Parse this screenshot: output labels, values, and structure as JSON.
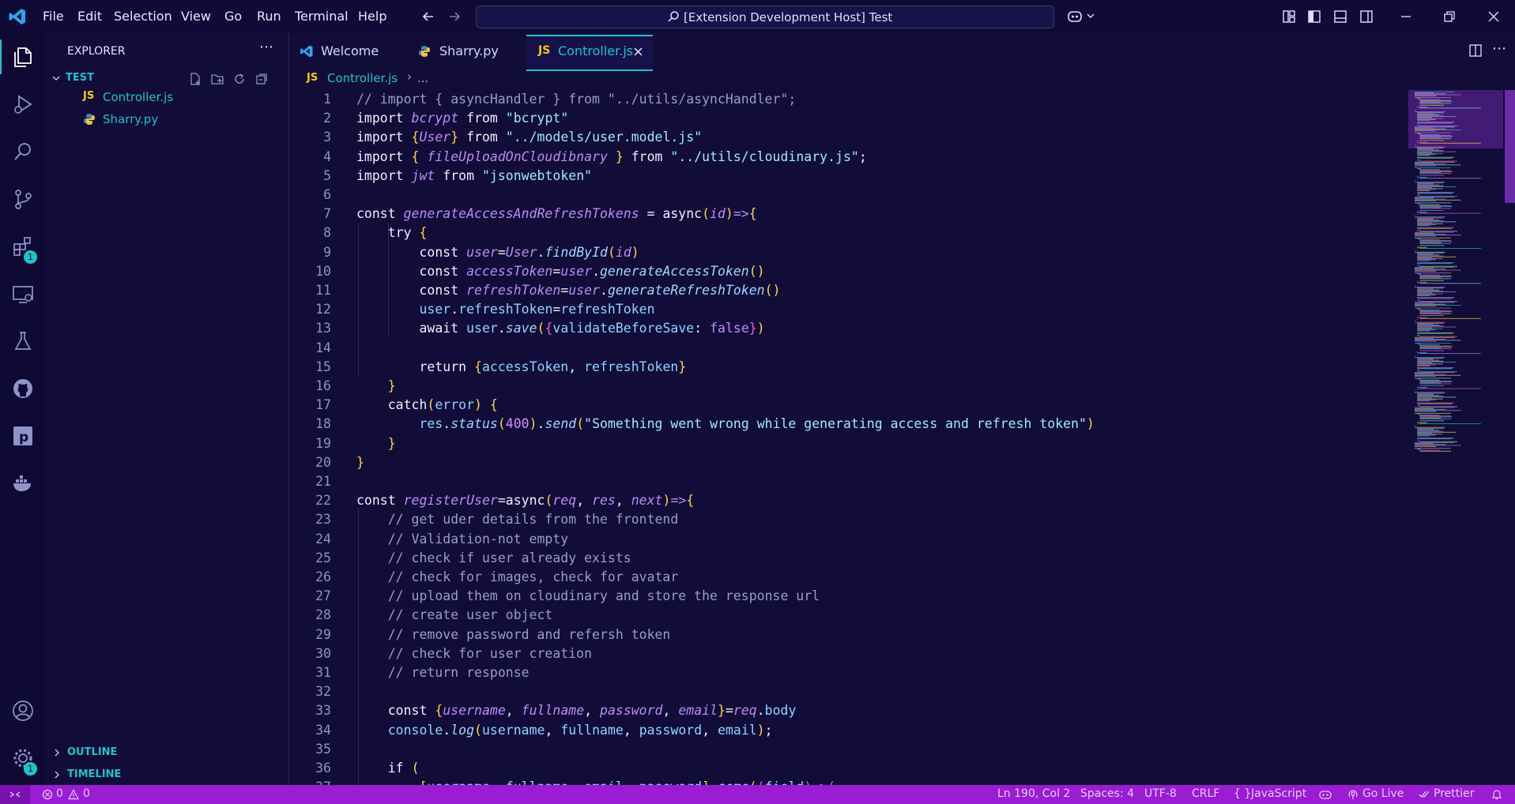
{
  "window": {
    "search_text": "[Extension Development Host] Test",
    "menu": [
      "File",
      "Edit",
      "Selection",
      "View",
      "Go",
      "Run",
      "Terminal",
      "Help"
    ]
  },
  "activity_bar": {
    "extensions_badge": "1",
    "accounts_badge": "1"
  },
  "sidebar": {
    "title": "EXPLORER",
    "folder": "TEST",
    "files": [
      {
        "name": "Controller.js",
        "icon": "JS"
      },
      {
        "name": "Sharry.py",
        "icon": "python"
      }
    ],
    "outline": "OUTLINE",
    "timeline": "TIMELINE"
  },
  "tabs": [
    {
      "label": "Welcome"
    },
    {
      "label": "Sharry.py"
    },
    {
      "label": "Controller.js",
      "active": true
    }
  ],
  "breadcrumb": {
    "icon": "JS",
    "file": "Controller.js",
    "more": "..."
  },
  "editor": {
    "lines": [
      "// import { asyncHandler } from \"../utils/asyncHandler\";",
      "import bcrypt from \"bcrypt\"",
      "import {User} from \"../models/user.model.js\"",
      "import { fileUploadOnCloudibnary } from \"../utils/cloudinary.js\";",
      "import jwt from \"jsonwebtoken\"",
      "",
      "const generateAccessAndRefreshTokens = async(id)=>{",
      "    try {",
      "        const user=User.findById(id)",
      "        const accessToken=user.generateAccessToken()",
      "        const refreshToken=user.generateRefreshToken()",
      "        user.refreshToken=refreshToken",
      "        await user.save({validateBeforeSave: false})",
      "",
      "        return {accessToken, refreshToken}",
      "    }",
      "    catch(error) {",
      "        res.status(400).send(\"Something went wrong while generating access and refresh token\")",
      "    }",
      "}",
      "",
      "const registerUser=async(req, res, next)=>{",
      "    // get uder details from the frontend",
      "    // Validation-not empty",
      "    // check if user already exists",
      "    // check for images, check for avatar",
      "    // upload them on cloudinary and store the response url",
      "    // create user object",
      "    // remove password and refersh token",
      "    // check for user creation",
      "    // return response",
      "",
      "    const {username, fullname, password, email}=req.body",
      "    console.log(username, fullname, password, email);",
      "",
      "    if (",
      "        [username, fullname, email, password].some((field)=>("
    ]
  },
  "status_bar": {
    "errors": "0",
    "warnings": "0",
    "position": "Ln 190, Col 2",
    "spaces": "Spaces: 4",
    "encoding": "UTF-8",
    "eol": "CRLF",
    "language": "JavaScript",
    "go_live": "Go Live",
    "prettier": "Prettier"
  },
  "colors": {
    "background": "#110c38",
    "accent": "#1ec3c8",
    "status_bar": "#9a1cd3"
  }
}
